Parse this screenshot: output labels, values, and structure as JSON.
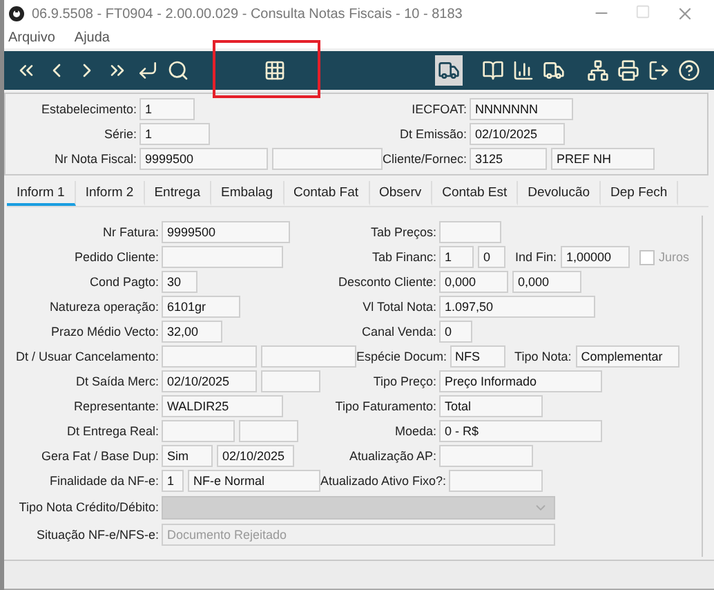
{
  "window": {
    "title": "06.9.5508 - FT0904 - 2.00.00.029 - Consulta Notas Fiscais - 10 - 8183"
  },
  "menu": [
    "Arquivo",
    "Ajuda"
  ],
  "toolbar": [
    {
      "kind": "first",
      "pressed": false
    },
    {
      "kind": "prev",
      "pressed": false
    },
    {
      "kind": "next",
      "pressed": false
    },
    {
      "kind": "last",
      "pressed": false
    },
    {
      "kind": "enter",
      "pressed": false
    },
    {
      "kind": "search",
      "pressed": false
    },
    {
      "kind": "grid",
      "pressed": false
    },
    {
      "kind": "truck",
      "pressed": true
    },
    {
      "kind": "book",
      "pressed": false
    },
    {
      "kind": "chart",
      "pressed": false
    },
    {
      "kind": "truck-money",
      "pressed": false
    },
    {
      "kind": "tree",
      "pressed": false
    },
    {
      "kind": "print",
      "pressed": false
    },
    {
      "kind": "exit",
      "pressed": false
    },
    {
      "kind": "help",
      "pressed": false
    }
  ],
  "header": [
    {
      "left": {
        "label": "Estabelecimento:",
        "fields": [
          {
            "value": "1"
          }
        ]
      },
      "right": {
        "label": "IECFOAT:",
        "fields": [
          {
            "value": "NNNNNNN"
          }
        ]
      }
    },
    {
      "left": {
        "label": "Série:",
        "fields": [
          {
            "value": "1"
          }
        ]
      },
      "right": {
        "label": "Dt Emissão:",
        "fields": [
          {
            "value": "02/10/2025"
          }
        ]
      }
    },
    {
      "left": {
        "label": "Nr Nota Fiscal:",
        "fields": [
          {
            "value": "9999500"
          },
          {
            "kind": "field"
          }
        ]
      },
      "right": {
        "label": "Cliente/Fornec:",
        "fields": [
          {
            "value": "3125"
          },
          {
            "value": "PREF  NH"
          }
        ]
      }
    }
  ],
  "tabs": [
    {
      "label": "Inform 1",
      "selected": true
    },
    {
      "label": "Inform 2",
      "selected": false
    },
    {
      "label": "Entrega",
      "selected": false
    },
    {
      "label": "Embalag",
      "selected": false
    },
    {
      "label": "Contab Fat",
      "selected": false
    },
    {
      "label": "Observ",
      "selected": false
    },
    {
      "label": "Contab Est",
      "selected": false
    },
    {
      "label": "Devolucão",
      "selected": false
    },
    {
      "label": "Dep Fech",
      "selected": false
    }
  ],
  "rows": [
    {
      "kind": "pair",
      "left": {
        "label": "Nr Fatura:",
        "fields": [
          {
            "value": "9999500"
          }
        ]
      },
      "right": {
        "label": "Tab Preços:",
        "items": [
          {
            "kind": "field"
          }
        ]
      }
    },
    {
      "kind": "pair",
      "left": {
        "label": "Pedido Cliente:",
        "fields": [
          {
            "kind": "field"
          }
        ]
      },
      "right": {
        "label": "Tab Financ:",
        "items": [
          {
            "kind": "field",
            "value": "1"
          },
          {
            "kind": "field",
            "value": "0"
          },
          {
            "kind": "label",
            "value": "Ind Fin:"
          },
          {
            "kind": "field",
            "value": "1,00000"
          },
          {
            "kind": "checkbox",
            "value": "Juros",
            "checked": false,
            "disabled": true
          }
        ]
      }
    },
    {
      "kind": "pair",
      "left": {
        "label": "Cond Pagto:",
        "fields": [
          {
            "value": "30"
          }
        ]
      },
      "right": {
        "label": "Desconto Cliente:",
        "items": [
          {
            "kind": "field",
            "value": "0,000"
          },
          {
            "kind": "field",
            "value": "0,000"
          }
        ]
      }
    },
    {
      "kind": "pair",
      "left": {
        "label": "Natureza operação:",
        "fields": [
          {
            "value": "6101gr"
          }
        ]
      },
      "right": {
        "label": "Vl Total Nota:",
        "items": [
          {
            "kind": "field",
            "value": "1.097,50"
          }
        ]
      }
    },
    {
      "kind": "pair",
      "left": {
        "label": "Prazo Médio Vecto:",
        "fields": [
          {
            "value": "32,00"
          }
        ]
      },
      "right": {
        "label": "Canal Venda:",
        "items": [
          {
            "kind": "field",
            "value": "0"
          }
        ]
      }
    },
    {
      "kind": "pair",
      "left": {
        "label": "Dt / Usuar Cancelamento:",
        "fields": [
          {
            "kind": "field"
          },
          {
            "kind": "field"
          }
        ]
      },
      "right": {
        "label": "Espécie Docum:",
        "items": [
          {
            "kind": "field",
            "value": "NFS"
          },
          {
            "kind": "label",
            "value": "Tipo Nota:"
          },
          {
            "kind": "field",
            "value": "Complementar"
          }
        ]
      }
    },
    {
      "kind": "pair",
      "left": {
        "label": "Dt Saída Merc:",
        "fields": [
          {
            "value": "02/10/2025"
          },
          {
            "kind": "field"
          }
        ]
      },
      "right": {
        "label": "Tipo Preço:",
        "items": [
          {
            "kind": "field",
            "value": "Preço Informado"
          }
        ]
      }
    },
    {
      "kind": "pair",
      "left": {
        "label": "Representante:",
        "fields": [
          {
            "value": "WALDIR25"
          }
        ]
      },
      "right": {
        "label": "Tipo Faturamento:",
        "items": [
          {
            "kind": "field",
            "value": "Total"
          }
        ]
      }
    },
    {
      "kind": "pair",
      "left": {
        "label": "Dt Entrega Real:",
        "fields": [
          {
            "kind": "field"
          },
          {
            "kind": "field"
          }
        ]
      },
      "right": {
        "label": "Moeda:",
        "items": [
          {
            "kind": "field",
            "value": "0 - R$"
          }
        ]
      }
    },
    {
      "kind": "pair",
      "left": {
        "label": "Gera Fat / Base Dup:",
        "fields": [
          {
            "value": "Sim"
          },
          {
            "value": "02/10/2025"
          }
        ]
      },
      "right": {
        "label": "Atualização AP:",
        "items": [
          {
            "kind": "field"
          }
        ]
      }
    },
    {
      "kind": "pair",
      "left": {
        "label": "Finalidade da NF-e:",
        "fields": [
          {
            "value": "1"
          },
          {
            "value": "NF-e Normal"
          }
        ]
      },
      "right": {
        "label": "Atualizado Ativo Fixo?:",
        "items": [
          {
            "kind": "field"
          }
        ]
      }
    },
    {
      "kind": "select",
      "label": "Tipo Nota Crédito/Débito:",
      "disabled": true
    },
    {
      "kind": "wide",
      "label": "Situação NF-e/NFS-e:",
      "value": "Documento Rejeitado",
      "disabled": true
    }
  ]
}
